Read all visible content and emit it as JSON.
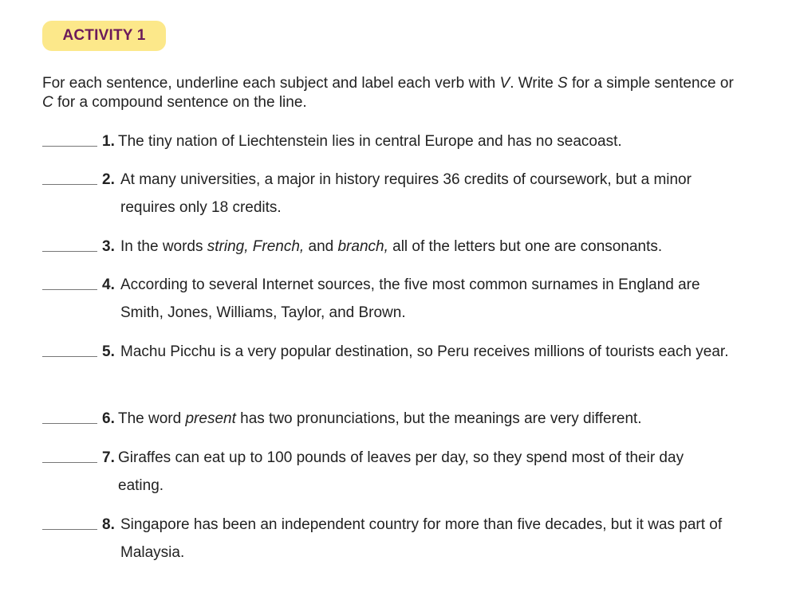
{
  "activity": {
    "label": "ACTIVITY 1"
  },
  "instructions": {
    "part1": "For each sentence, underline each subject and label each verb with ",
    "v": "V",
    "part2": ". Write ",
    "s": "S",
    "part3": " for a simple sentence or ",
    "c": "C",
    "part4": " for a compound sentence on the line."
  },
  "items": [
    {
      "number": "1.",
      "text": "The tiny nation of Liechtenstein lies in central Europe and has no seacoast."
    },
    {
      "number": "2.",
      "text": "At many universities, a major in history requires 36 credits of coursework, but a minor requires only 18 credits."
    },
    {
      "number": "3.",
      "t1": "In the words ",
      "e1": "string, French,",
      "t2": " and ",
      "e2": "branch,",
      "t3": " all of the letters but one are consonants."
    },
    {
      "number": "4.",
      "text": "According to several Internet sources, the five most common surnames in England are Smith, Jones, Williams, Taylor, and Brown."
    },
    {
      "number": "5.",
      "text": "Machu Picchu is a very popular destination, so Peru receives millions of tourists each year."
    },
    {
      "number": "6.",
      "t1": "The word ",
      "e1": "present",
      "t2": " has two pronunciations, but the meanings are very different."
    },
    {
      "number": "7.",
      "text": "Giraffes can eat up to 100 pounds of leaves per day, so they spend most of their day eating."
    },
    {
      "number": "8.",
      "text": "Singapore has been an independent country for more than five decades, but it was part of Malaysia."
    }
  ]
}
